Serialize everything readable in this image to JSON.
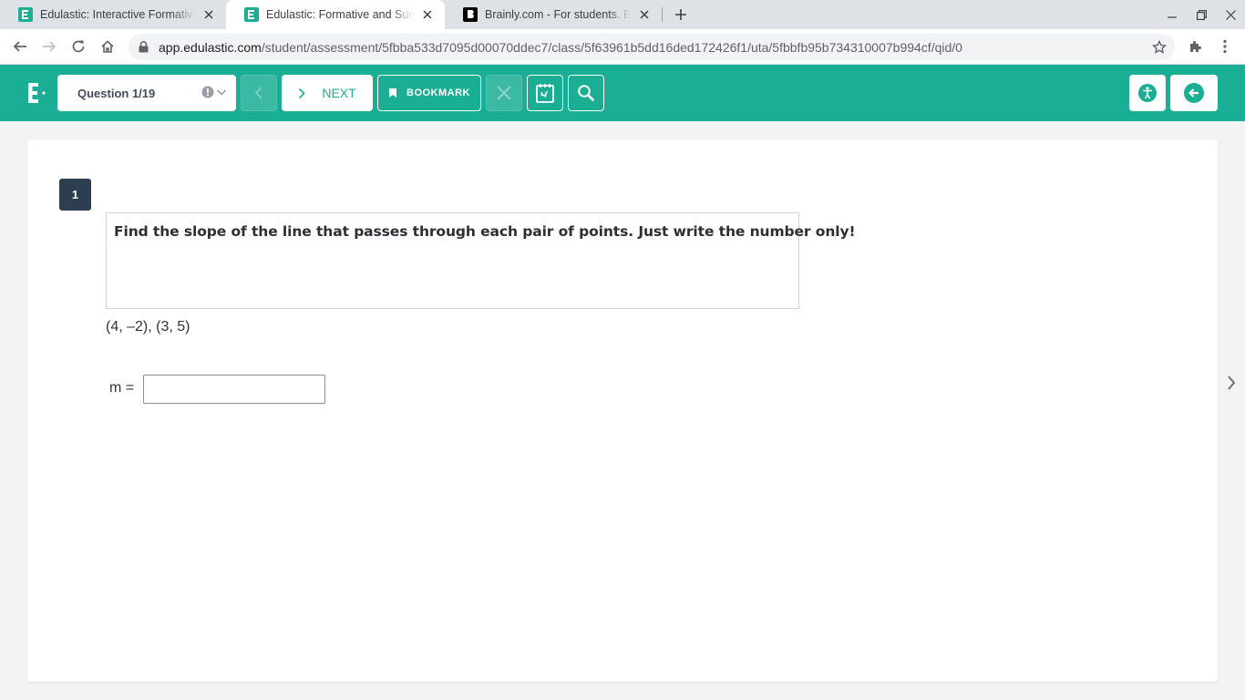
{
  "browser": {
    "tabs": [
      {
        "title": "Edulastic: Interactive Formative Assessment",
        "active": false
      },
      {
        "title": "Edulastic: Formative and Summative Assessment",
        "active": true
      },
      {
        "title": "Brainly.com - For students. By students.",
        "active": false
      }
    ],
    "url_host": "app.edulastic.com",
    "url_path": "/student/assessment/5fbba533d7095d00070ddec7/class/5f63961b5dd16ded172426f1/uta/5fbbfb95b734310007b994cf/qid/0"
  },
  "header": {
    "question_selector": "Question 1/19",
    "next_label": "NEXT",
    "bookmark_label": "BOOKMARK"
  },
  "question": {
    "number": "1",
    "stem": "Find the slope of the line that passes through each pair of points. Just write the number only!",
    "points": "(4, –2), (3, 5)",
    "answer_label": "m =",
    "answer_value": ""
  },
  "colors": {
    "brand_teal": "#1aae94",
    "number_badge": "#2d3e50"
  }
}
